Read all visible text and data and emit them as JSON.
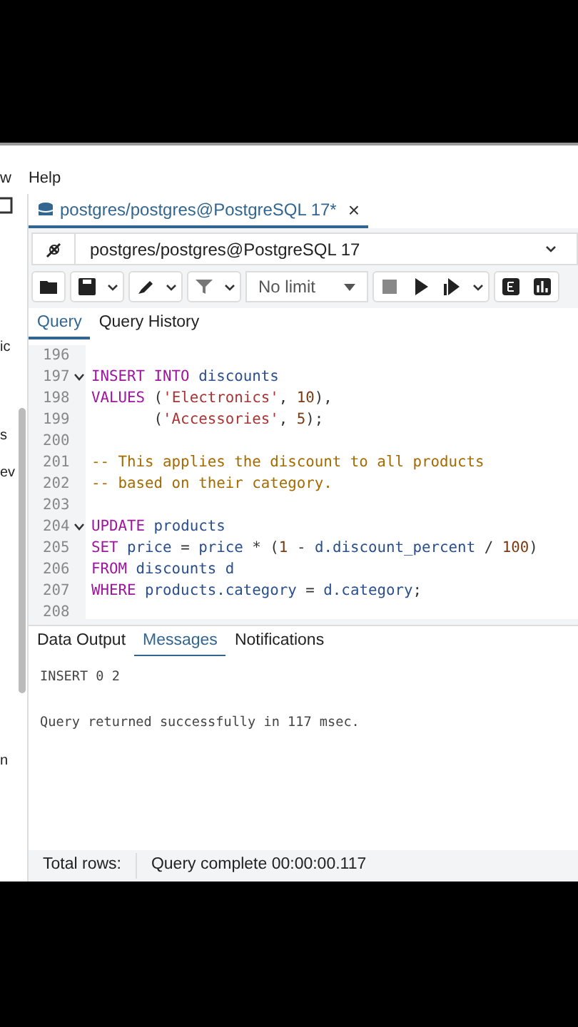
{
  "menu": {
    "cut_item": "w",
    "items": [
      "Help"
    ]
  },
  "side_pane": {
    "fragments": [
      "ic",
      "s",
      "ev",
      "n"
    ]
  },
  "editor_tab": {
    "title": "postgres/postgres@PostgreSQL 17*",
    "close": "×",
    "selected": true
  },
  "connection": {
    "value": "postgres/postgres@PostgreSQL 17"
  },
  "toolbar": {
    "limit": "No limit"
  },
  "query_tabs": [
    {
      "label": "Query",
      "selected": true
    },
    {
      "label": "Query History",
      "selected": false
    }
  ],
  "code_lines": [
    {
      "number": "196",
      "fold": false
    },
    {
      "number": "197",
      "fold": true,
      "tokens": [
        {
          "kind": "keyword",
          "text": "INSERT INTO"
        },
        {
          "kind": "ident",
          "text": " discounts"
        }
      ]
    },
    {
      "number": "198",
      "fold": false,
      "tokens": [
        {
          "kind": "keyword",
          "text": "VALUES"
        },
        {
          "kind": "plain",
          "text": " ("
        },
        {
          "kind": "string",
          "text": "'Electronics'"
        },
        {
          "kind": "plain",
          "text": ", "
        },
        {
          "kind": "number",
          "text": "10"
        },
        {
          "kind": "plain",
          "text": "),"
        }
      ]
    },
    {
      "number": "199",
      "fold": false,
      "tokens": [
        {
          "kind": "plain",
          "text": "       ("
        },
        {
          "kind": "string",
          "text": "'Accessories'"
        },
        {
          "kind": "plain",
          "text": ", "
        },
        {
          "kind": "number",
          "text": "5"
        },
        {
          "kind": "plain",
          "text": ");"
        }
      ]
    },
    {
      "number": "200",
      "fold": false
    },
    {
      "number": "201",
      "fold": false,
      "tokens": [
        {
          "kind": "comment",
          "text": "-- This applies the discount to all products"
        }
      ]
    },
    {
      "number": "202",
      "fold": false,
      "tokens": [
        {
          "kind": "comment",
          "text": "-- based on their category."
        }
      ]
    },
    {
      "number": "203",
      "fold": false
    },
    {
      "number": "204",
      "fold": true,
      "tokens": [
        {
          "kind": "keyword",
          "text": "UPDATE"
        },
        {
          "kind": "ident",
          "text": " products"
        }
      ]
    },
    {
      "number": "205",
      "fold": false,
      "tokens": [
        {
          "kind": "keyword",
          "text": "SET"
        },
        {
          "kind": "ident",
          "text": " price"
        },
        {
          "kind": "plain",
          "text": " = "
        },
        {
          "kind": "ident",
          "text": "price"
        },
        {
          "kind": "plain",
          "text": " * ("
        },
        {
          "kind": "number",
          "text": "1"
        },
        {
          "kind": "plain",
          "text": " - "
        },
        {
          "kind": "ident",
          "text": "d.discount_percent"
        },
        {
          "kind": "plain",
          "text": " / "
        },
        {
          "kind": "number",
          "text": "100"
        },
        {
          "kind": "plain",
          "text": ")"
        }
      ]
    },
    {
      "number": "206",
      "fold": false,
      "tokens": [
        {
          "kind": "keyword",
          "text": "FROM"
        },
        {
          "kind": "ident",
          "text": " discounts d"
        }
      ]
    },
    {
      "number": "207",
      "fold": false,
      "tokens": [
        {
          "kind": "keyword",
          "text": "WHERE"
        },
        {
          "kind": "ident",
          "text": " products.category"
        },
        {
          "kind": "plain",
          "text": " = "
        },
        {
          "kind": "ident",
          "text": "d.category"
        },
        {
          "kind": "plain",
          "text": ";"
        }
      ]
    },
    {
      "number": "208",
      "fold": false
    }
  ],
  "output_tabs": [
    {
      "label": "Data Output",
      "selected": false
    },
    {
      "label": "Messages",
      "selected": true
    },
    {
      "label": "Notifications",
      "selected": false
    }
  ],
  "messages": [
    "INSERT 0 2",
    "Query returned successfully in 117 msec."
  ],
  "status_bar": {
    "total_rows": "Total rows:",
    "status": "Query complete 00:00:00.117"
  }
}
